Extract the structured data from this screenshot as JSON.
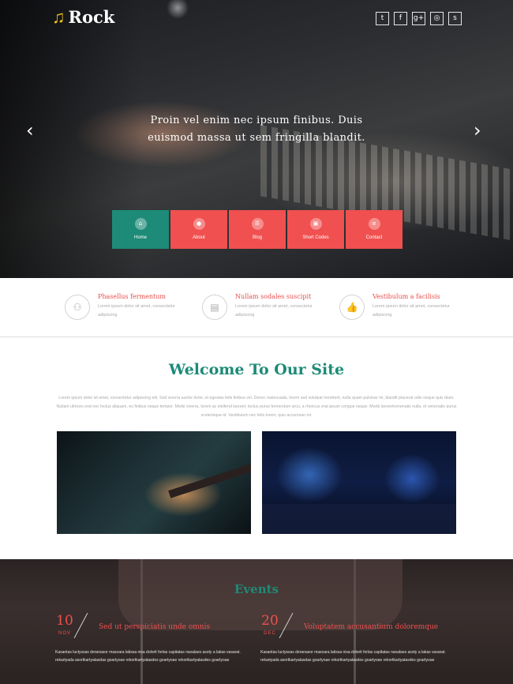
{
  "brand": {
    "note_icon": "music-note-icon",
    "name": "Rock",
    "accent": "#f2c31b"
  },
  "social": [
    {
      "name": "twitter",
      "glyph": "t"
    },
    {
      "name": "facebook",
      "glyph": "f"
    },
    {
      "name": "google-plus",
      "glyph": "g+"
    },
    {
      "name": "dribbble",
      "glyph": "◎"
    },
    {
      "name": "skype",
      "glyph": "s"
    }
  ],
  "hero": {
    "caption": "Proin vel enim nec ipsum finibus. Duis euismod massa ut sem fringilla blandit.",
    "prev": "‹",
    "next": "›"
  },
  "menu": [
    {
      "label": "Home",
      "icon": "⌂",
      "active": true
    },
    {
      "label": "About",
      "icon": "●"
    },
    {
      "label": "Blog",
      "icon": "☰"
    },
    {
      "label": "Short Codes",
      "icon": "▣"
    },
    {
      "label": "Contact",
      "icon": "≡"
    }
  ],
  "features": [
    {
      "icon": "⚇",
      "title": "Phasellus fermentum",
      "text": "Lorem ipsum dolor sit amet, consectetur adipiscing"
    },
    {
      "icon": "▤",
      "title": "Nullam sodales suscipit",
      "text": "Lorem ipsum dolor sit amet, consectetur adipiscing"
    },
    {
      "icon": "👍",
      "title": "Vestibulum a facilisis",
      "text": "Lorem ipsum dolor sit amet, consectetur adipiscing"
    }
  ],
  "welcome": {
    "title": "Welcome To Our Site",
    "text": "Lorem ipsum dolor sit amet, consectetur adipiscing elit. Sed viverra auctor dolor, et egestas felis finibus vel. Donec malesuada, lorem sed volutpat hendrerit, nulla quam pulvinar mi, blandit placerat odio neque quis diam. Nullam ultrices erat nec lectus aliquam, eu finibus neque tempor. Morbi viverra, lorem ac eleifend laoreet, lectus purus fermentum arcu, a rhoncus erat ipsum congue neque. Morbi laoreetvenenatis nulla, et venenatis purus scelerisque id. Vestibulum nec felis lorem, quis accumsan mi."
  },
  "events": {
    "title": "Events",
    "items": [
      {
        "day": "10",
        "month": "NOV",
        "title": "Sed ut perspiciatis unde omnis",
        "text": "Kasantas luctyssas deranasor masoara latissa nisa dolorit forlas capitatas navalaes asoty a lakas vasarat. rekartyada asortkartyatasdas goartyoae rekortkartyatasdes goartyoae rekortkartyatasdes goartyoae"
      },
      {
        "day": "20",
        "month": "DEC",
        "title": "Voluptatem accusantium doloremque",
        "text": "Kasantas luctyssas deranasor masoara latissa nisa dolorit forlas capitatas navalaes asoty a lakas vasarat. rekartyada asortkartyatasdas goartyoae rekortkartyatasdes goartyoae rekortkartyatasdes goartyoae"
      }
    ]
  },
  "colors": {
    "green": "#1d8b77",
    "red": "#f0504f",
    "gold": "#f2c31b"
  }
}
